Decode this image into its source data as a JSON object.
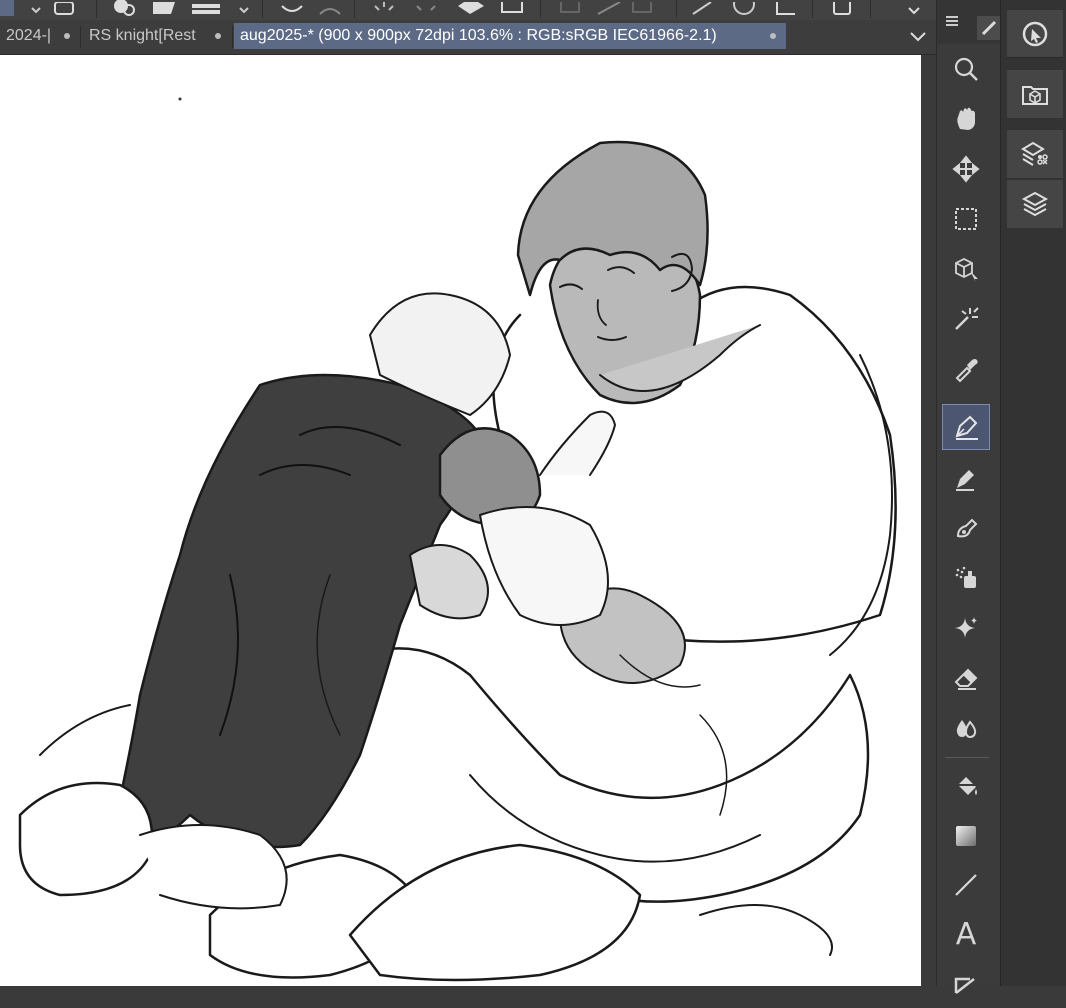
{
  "tabs": [
    {
      "title": "2024-|",
      "active": false
    },
    {
      "title": "RS knight[Rest",
      "active": false
    },
    {
      "title": "aug2025-* (900 x 900px 72dpi 103.6% : RGB:sRGB IEC61966-2.1)",
      "active": true
    }
  ],
  "canvas": {
    "document_name": "aug2025-*",
    "zoom": "103.6%",
    "background_color": "#ffffff"
  },
  "tools": [
    {
      "name": "zoom-tool",
      "icon": "magnifier-icon"
    },
    {
      "name": "hand-tool",
      "icon": "hand-icon"
    },
    {
      "name": "move-tool",
      "icon": "move-arrows-icon"
    },
    {
      "name": "selection-tool",
      "icon": "dotted-rectangle-icon"
    },
    {
      "name": "3d-object-tool",
      "icon": "cube-cursor-icon"
    },
    {
      "name": "auto-select-tool",
      "icon": "magic-wand-icon"
    },
    {
      "name": "eyedropper-tool",
      "icon": "eyedropper-icon"
    },
    {
      "name": "pen-tool",
      "icon": "pen-nib-icon",
      "selected": true
    },
    {
      "name": "pencil-tool",
      "icon": "pencil-icon"
    },
    {
      "name": "brush-tool",
      "icon": "brush-icon"
    },
    {
      "name": "airbrush-tool",
      "icon": "airbrush-icon"
    },
    {
      "name": "decoration-tool",
      "icon": "sparkle-icon"
    },
    {
      "name": "eraser-tool",
      "icon": "eraser-icon"
    },
    {
      "name": "blend-tool",
      "icon": "droplets-icon"
    },
    {
      "name": "fill-tool",
      "icon": "paint-bucket-icon"
    },
    {
      "name": "gradient-tool",
      "icon": "gradient-icon"
    },
    {
      "name": "figure-tool",
      "icon": "line-icon"
    },
    {
      "name": "text-tool",
      "icon": "text-a-icon",
      "label": "A"
    },
    {
      "name": "frame-border-tool",
      "icon": "frame-border-icon"
    }
  ],
  "dock": [
    {
      "name": "navigator-panel-button",
      "icon": "navigator-icon"
    },
    {
      "name": "material-panel-button",
      "icon": "material-box-icon"
    },
    {
      "name": "layer-property-button",
      "icon": "layer-property-icon"
    },
    {
      "name": "layer-panel-button",
      "icon": "layers-icon"
    }
  ],
  "colors": {
    "active_tab": "#5d6a85",
    "selected_tool": "#4c5670",
    "panel_bg": "#3b3b3b",
    "icon": "#d6d6d6"
  }
}
